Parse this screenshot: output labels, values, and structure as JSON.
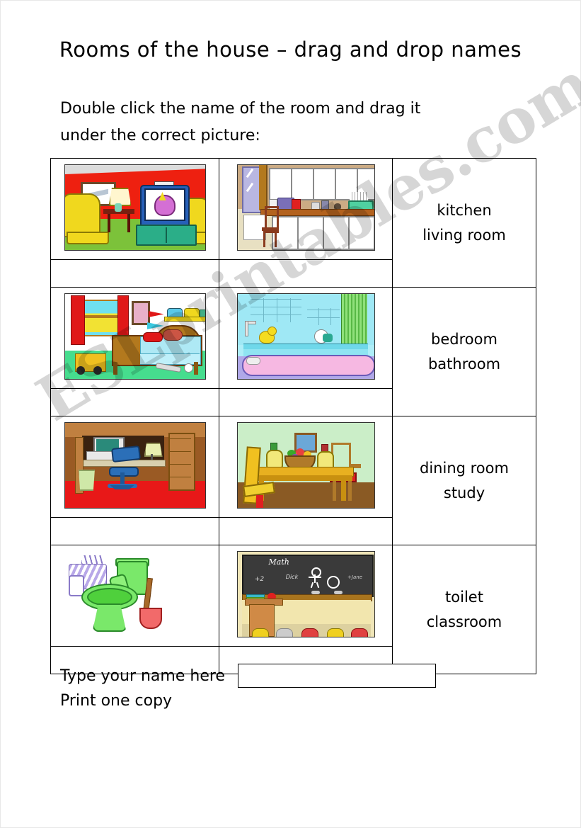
{
  "document": {
    "title": "Rooms of the house – drag and drop names",
    "instructions_line1": "Double click the name of the room and drag it",
    "instructions_line2": "under the correct picture:",
    "watermark": "ESLprintables.com"
  },
  "worksheet": {
    "rows": [
      {
        "pictures": [
          {
            "name": "living-room-illustration",
            "alt": "Living room with red walls, yellow armchairs, television and lamp"
          },
          {
            "name": "kitchen-illustration",
            "alt": "Kitchen with white cupboards, wooden counter, chair and dish rack"
          }
        ],
        "words": [
          "kitchen",
          "living room"
        ],
        "answers": [
          "",
          ""
        ]
      },
      {
        "pictures": [
          {
            "name": "bedroom-illustration",
            "alt": "Bedroom with red curtains, bed with blue blanket, toys and shelf"
          },
          {
            "name": "bathroom-illustration",
            "alt": "Bathroom with bathtub, rubber duck, green curtain and pink mat"
          }
        ],
        "words": [
          "bedroom",
          "bathroom"
        ],
        "answers": [
          "",
          ""
        ]
      },
      {
        "pictures": [
          {
            "name": "study-illustration",
            "alt": "Study with desk, computer, blue office chair and red carpet"
          },
          {
            "name": "dining-room-illustration",
            "alt": "Dining room with yellow table, chairs, fruit bowl and bottles"
          }
        ],
        "words": [
          "dining room",
          "study"
        ],
        "answers": [
          "",
          ""
        ]
      },
      {
        "pictures": [
          {
            "name": "toilet-illustration",
            "alt": "Green toilet with red plunger and toilet paper roll"
          },
          {
            "name": "classroom-illustration",
            "alt": "Classroom with blackboard reading Math and teacher's desk with apple"
          }
        ],
        "words": [
          "toilet",
          "classroom"
        ],
        "answers": [
          "",
          ""
        ]
      }
    ]
  },
  "footer": {
    "name_label": "Type your name here",
    "name_value": "",
    "name_placeholder": "",
    "print_label": "Print one copy"
  },
  "chalkboard": {
    "heading": "Math",
    "note1": "+2",
    "note2": "Dick",
    "note3": "+Jane"
  }
}
